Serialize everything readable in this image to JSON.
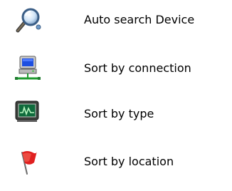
{
  "items": [
    {
      "label": "Auto search Device",
      "icon": "magnifier-icon"
    },
    {
      "label": "Sort by connection",
      "icon": "network-computer-icon"
    },
    {
      "label": "Sort by type",
      "icon": "monitor-waveform-icon"
    },
    {
      "label": "Sort by location",
      "icon": "red-flag-icon"
    }
  ]
}
